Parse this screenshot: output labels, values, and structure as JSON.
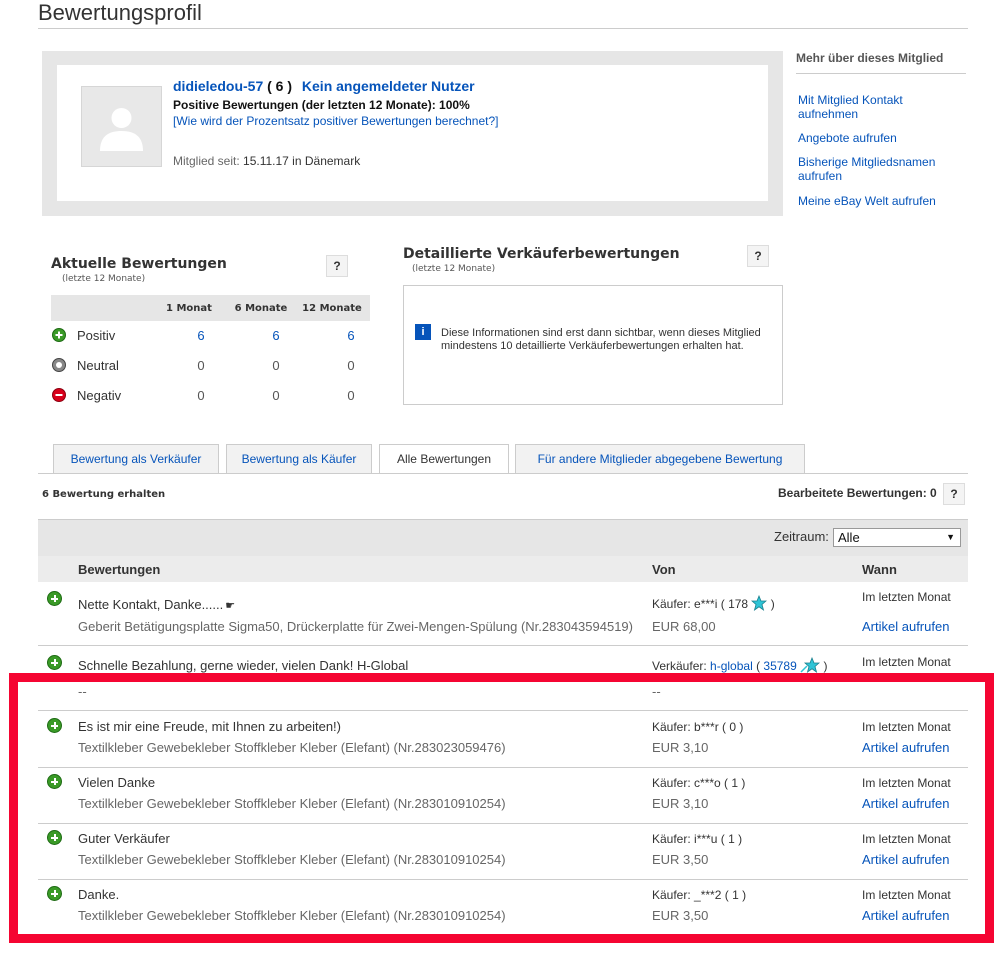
{
  "page": {
    "title": "Bewertungsprofil"
  },
  "member": {
    "name": "didieledou-57",
    "score": "( 6 )",
    "unauth": "Kein angemeldeter Nutzer",
    "positive_line": "Positive Bewertungen (der letzten 12 Monate): 100%",
    "percent_link": "[Wie wird der Prozentsatz positiver Bewertungen berechnet?]",
    "since_label": "Mitglied seit: ",
    "since_value": "15.11.17 in Dänemark"
  },
  "side": {
    "title": "Mehr über dieses Mitglied",
    "links": [
      "Mit Mitglied Kontakt aufnehmen",
      "Angebote aufrufen",
      "Bisherige Mitgliedsnamen aufrufen",
      "Meine eBay Welt aufrufen"
    ]
  },
  "current": {
    "title": "Aktuelle Bewertungen",
    "subtitle": "(letzte 12 Monate)",
    "help": "?",
    "columns": [
      "1 Monat",
      "6 Monate",
      "12 Monate"
    ],
    "rows": [
      {
        "label": "Positiv",
        "values": [
          "6",
          "6",
          "6"
        ]
      },
      {
        "label": "Neutral",
        "values": [
          "0",
          "0",
          "0"
        ]
      },
      {
        "label": "Negativ",
        "values": [
          "0",
          "0",
          "0"
        ]
      }
    ]
  },
  "detailed": {
    "title": "Detaillierte Verkäuferbewertungen",
    "subtitle": "(letzte 12 Monate)",
    "help": "?",
    "info_icon": "i",
    "info_text": "Diese Informationen sind erst dann sichtbar, wenn dieses Mitglied mindestens 10 detaillierte Verkäuferbewertungen erhalten hat."
  },
  "tabs": [
    "Bewertung als Verkäufer",
    "Bewertung als Käufer",
    "Alle Bewertungen",
    "Für andere Mitglieder abgegebene Bewertung"
  ],
  "summary": {
    "received": "6 Bewertung erhalten",
    "edited": "Bearbeitete Bewertungen: 0",
    "help": "?"
  },
  "filter": {
    "label": "Zeitraum:",
    "value": "Alle",
    "arrow": "▼"
  },
  "table": {
    "headers": [
      "Bewertungen",
      "Von",
      "Wann"
    ],
    "rows": [
      {
        "comment": "Nette Kontakt, Danke......",
        "item": "Geberit Betätigungsplatte Sigma50, Drückerplatte für Zwei-Mengen-Spülung (Nr.283043594519)",
        "role": "Käufer: ",
        "user": "e***i",
        "score_open": " ( ",
        "score": "178",
        "score_close": " )",
        "price": "EUR 68,00",
        "when": "Im letzten Monat",
        "link": "Artikel aufrufen"
      },
      {
        "comment": "Schnelle Bezahlung, gerne wieder, vielen Dank! H-Global",
        "item": "--",
        "role": "Verkäufer: ",
        "user": "h-global",
        "score_open": " ( ",
        "score": "35789",
        "score_close": " )",
        "price": "--",
        "when": "Im letzten Monat",
        "link": ""
      },
      {
        "comment": "Es ist mir eine Freude, mit Ihnen zu arbeiten!)",
        "item": "Textilkleber Gewebekleber Stoffkleber Kleber (Elefant) (Nr.283023059476)",
        "role": "Käufer: ",
        "user": "b***r",
        "score_open": " ( ",
        "score": "0",
        "score_close": " )",
        "price": "EUR 3,10",
        "when": "Im letzten Monat",
        "link": "Artikel aufrufen"
      },
      {
        "comment": "Vielen Danke",
        "item": "Textilkleber Gewebekleber Stoffkleber Kleber (Elefant) (Nr.283010910254)",
        "role": "Käufer: ",
        "user": "c***o",
        "score_open": " ( ",
        "score": "1",
        "score_close": " )",
        "price": "EUR 3,10",
        "when": "Im letzten Monat",
        "link": "Artikel aufrufen"
      },
      {
        "comment": "Guter Verkäufer",
        "item": "Textilkleber Gewebekleber Stoffkleber Kleber (Elefant) (Nr.283010910254)",
        "role": "Käufer: ",
        "user": "i***u",
        "score_open": " ( ",
        "score": "1",
        "score_close": " )",
        "price": "EUR 3,50",
        "when": "Im letzten Monat",
        "link": "Artikel aufrufen"
      },
      {
        "comment": "Danke.",
        "item": "Textilkleber Gewebekleber Stoffkleber Kleber (Elefant) (Nr.283010910254)",
        "role": "Käufer: ",
        "user": "_***2",
        "score_open": " ( ",
        "score": "1",
        "score_close": " )",
        "price": "EUR 3,50",
        "when": "Im letzten Monat",
        "link": "Artikel aufrufen"
      }
    ]
  },
  "colors": {
    "link": "#0654ba",
    "highlight": "#f50532",
    "positive": "#3a9a27",
    "negative": "#d9001b",
    "star": "#2ec4d6"
  }
}
